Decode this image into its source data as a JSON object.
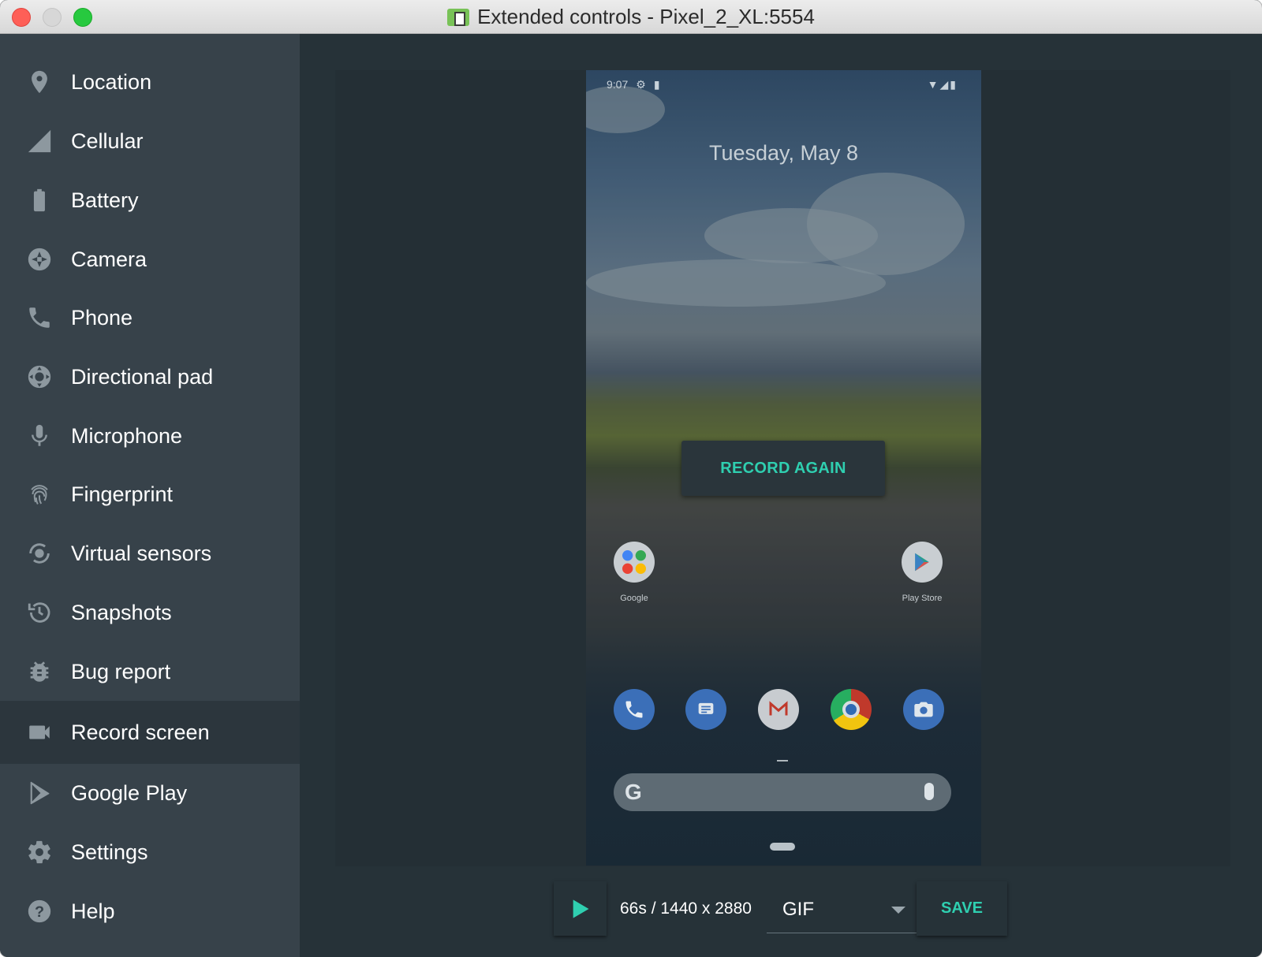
{
  "window": {
    "title": "Extended controls - Pixel_2_XL:5554"
  },
  "sidebar": {
    "items": [
      {
        "label": "Location",
        "icon": "location-pin-icon"
      },
      {
        "label": "Cellular",
        "icon": "cellular-signal-icon"
      },
      {
        "label": "Battery",
        "icon": "battery-icon"
      },
      {
        "label": "Camera",
        "icon": "camera-aperture-icon"
      },
      {
        "label": "Phone",
        "icon": "phone-icon"
      },
      {
        "label": "Directional pad",
        "icon": "dpad-icon"
      },
      {
        "label": "Microphone",
        "icon": "microphone-icon"
      },
      {
        "label": "Fingerprint",
        "icon": "fingerprint-icon"
      },
      {
        "label": "Virtual sensors",
        "icon": "rotation-sensor-icon"
      },
      {
        "label": "Snapshots",
        "icon": "history-icon"
      },
      {
        "label": "Bug report",
        "icon": "bug-icon"
      },
      {
        "label": "Record screen",
        "icon": "video-camera-icon",
        "active": true
      },
      {
        "label": "Google Play",
        "icon": "play-store-icon"
      },
      {
        "label": "Settings",
        "icon": "gear-icon"
      },
      {
        "label": "Help",
        "icon": "help-icon"
      }
    ]
  },
  "preview": {
    "status_time": "9:07",
    "date": "Tuesday, May 8",
    "record_again_label": "RECORD AGAIN",
    "apps": [
      {
        "label": "Google",
        "icon": "google-folder-icon"
      },
      {
        "label": "Play Store",
        "icon": "play-store-app-icon"
      }
    ],
    "dock": [
      "phone-app-icon",
      "messages-app-icon",
      "gmail-app-icon",
      "chrome-app-icon",
      "camera-app-icon"
    ]
  },
  "controls": {
    "info": "66s / 1440 x 2880",
    "format_selected": "GIF",
    "save_label": "SAVE"
  },
  "colors": {
    "accent": "#2fcfb0",
    "sidebar_bg": "#37424a",
    "main_bg": "#263238",
    "active_item_bg": "#2c363d"
  }
}
